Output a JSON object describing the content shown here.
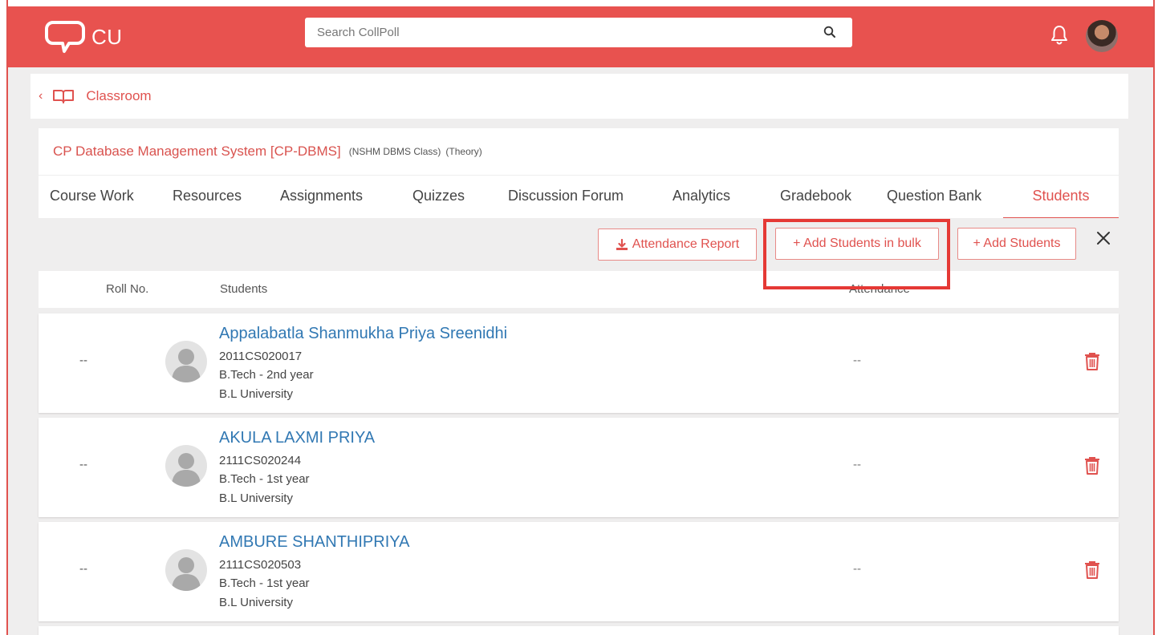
{
  "app": {
    "logo_text": "CU",
    "search_placeholder": "Search CollPoll",
    "accent_color": "#e8524f",
    "link_color": "#3178b3"
  },
  "breadcrumb": {
    "label": "Classroom"
  },
  "course": {
    "title": "CP Database Management System [CP-DBMS]",
    "class_name": "(NSHM DBMS Class)",
    "type": "(Theory)"
  },
  "tabs": [
    {
      "label": "Course Work"
    },
    {
      "label": "Resources"
    },
    {
      "label": "Assignments"
    },
    {
      "label": "Quizzes"
    },
    {
      "label": "Discussion Forum"
    },
    {
      "label": "Analytics"
    },
    {
      "label": "Gradebook"
    },
    {
      "label": "Question Bank"
    },
    {
      "label": "Students",
      "active": true
    }
  ],
  "actions": {
    "attendance_report": "Attendance Report",
    "add_bulk": "+ Add Students in bulk",
    "add_students": "+ Add Students"
  },
  "table": {
    "headers": {
      "roll": "Roll No.",
      "students": "Students",
      "attendance": "Attendance"
    },
    "rows": [
      {
        "roll": "--",
        "name": "Appalabatla Shanmukha Priya Sreenidhi",
        "id": "2011CS020017",
        "program": "B.Tech - 2nd year",
        "university": "B.L University",
        "attendance": "--"
      },
      {
        "roll": "--",
        "name": "AKULA LAXMI PRIYA",
        "id": "2111CS020244",
        "program": "B.Tech - 1st year",
        "university": "B.L University",
        "attendance": "--"
      },
      {
        "roll": "--",
        "name": "AMBURE SHANTHIPRIYA",
        "id": "2111CS020503",
        "program": "B.Tech - 1st year",
        "university": "B.L University",
        "attendance": "--"
      }
    ]
  }
}
